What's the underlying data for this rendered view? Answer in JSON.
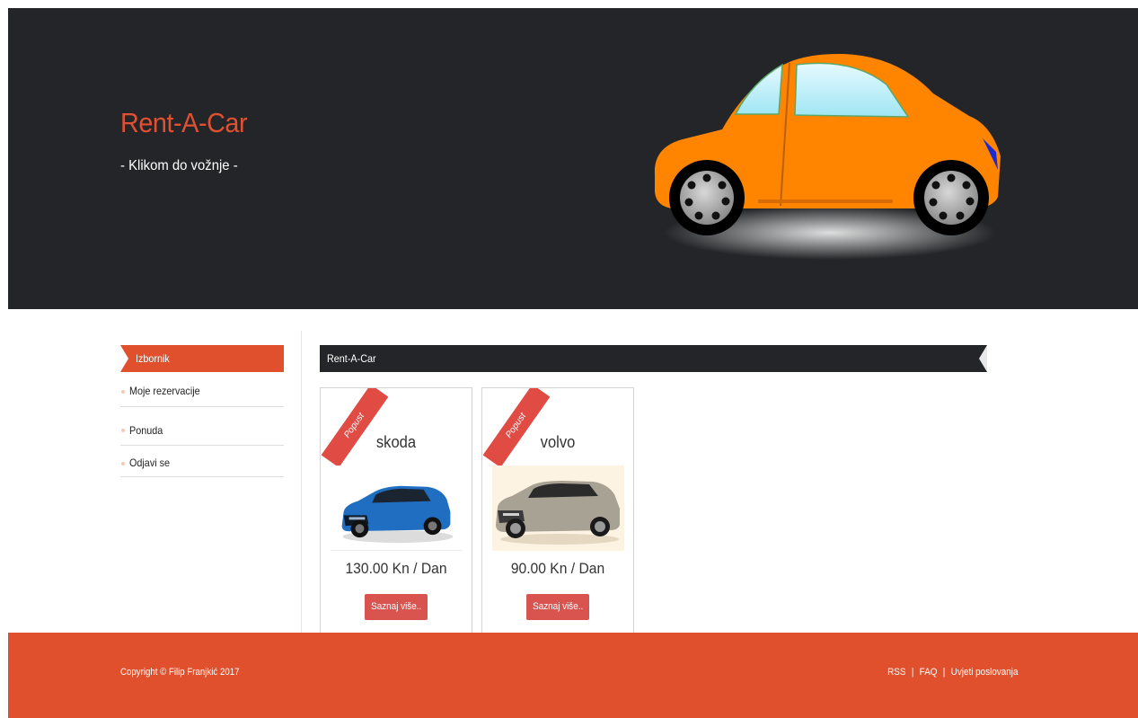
{
  "header": {
    "title": "Rent-A-Car",
    "subtitle": "- Klikom do vožnje -",
    "image": "cartoon-orange-car"
  },
  "sidebar": {
    "heading": "Izbornik",
    "items": [
      {
        "label": "Moje rezervacije"
      },
      {
        "label": "Ponuda"
      },
      {
        "label": "Odjavi se"
      }
    ]
  },
  "content": {
    "bar_title": "Rent-A-Car",
    "cars": [
      {
        "ribbon": "Popust",
        "name": "skoda",
        "image": "blue-skoda-wagon",
        "price": "130.00 Kn / Dan",
        "button": "Saznaj više.."
      },
      {
        "ribbon": "Popust",
        "name": "volvo",
        "image": "silver-volvo-suv",
        "price": "90.00 Kn / Dan",
        "button": "Saznaj više.."
      }
    ]
  },
  "footer": {
    "copyright": "Copyright © Filip Franjkić 2017",
    "links": [
      "RSS",
      "FAQ",
      "Uvjeti poslovanja"
    ],
    "separator": "|"
  },
  "colors": {
    "accent": "#e0502c",
    "dark": "#232528",
    "button": "#d9534f"
  }
}
